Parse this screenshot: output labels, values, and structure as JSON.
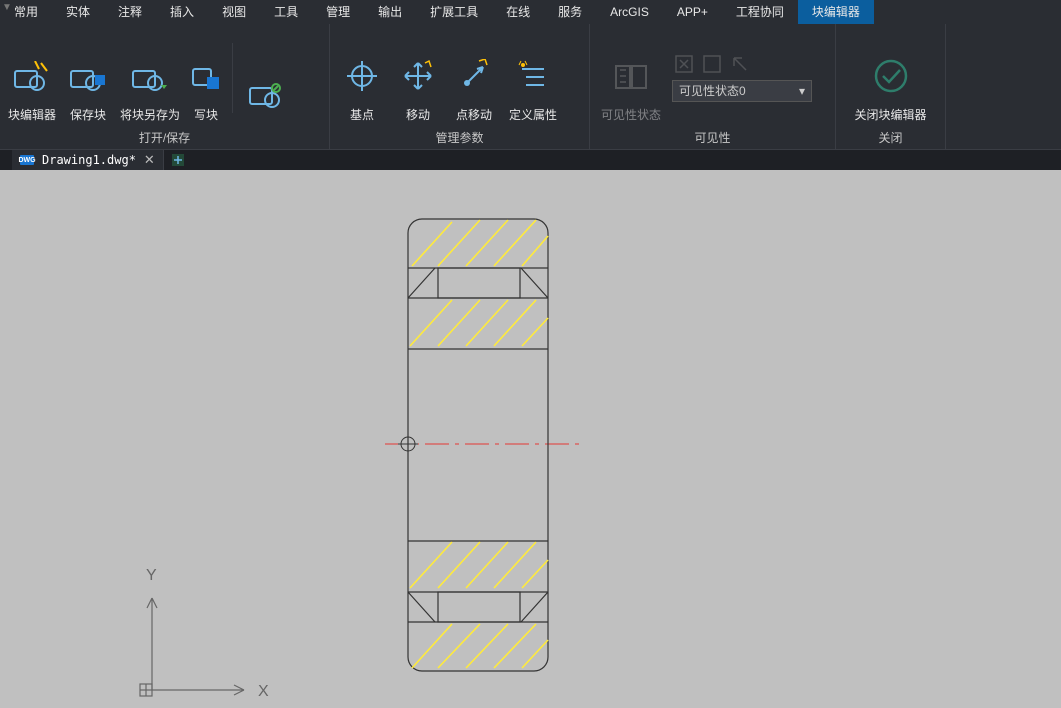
{
  "menubar": {
    "items": [
      "常用",
      "实体",
      "注释",
      "插入",
      "视图",
      "工具",
      "管理",
      "输出",
      "扩展工具",
      "在线",
      "服务",
      "ArcGIS",
      "APP+",
      "工程协同",
      "块编辑器"
    ],
    "active_index": 14
  },
  "ribbon": {
    "panels": [
      {
        "title": "打开/保存",
        "buttons": [
          {
            "label": "块编辑器",
            "icon": "block-editor"
          },
          {
            "label": "保存块",
            "icon": "save-block"
          },
          {
            "label": "将块另存为",
            "icon": "saveas-block"
          },
          {
            "label": "写块",
            "icon": "write-block"
          },
          {
            "sep": true
          },
          {
            "label": "测试块",
            "icon": "test-block"
          }
        ]
      },
      {
        "title": "管理参数",
        "buttons": [
          {
            "label": "基点",
            "icon": "basepoint"
          },
          {
            "label": "移动",
            "icon": "move"
          },
          {
            "label": "点移动",
            "icon": "point-move"
          },
          {
            "label": "定义属性",
            "icon": "def-attr"
          }
        ]
      },
      {
        "title": "可见性",
        "buttons": [
          {
            "label": "可见性状态",
            "icon": "vis-state",
            "disabled": true
          }
        ],
        "combo": {
          "value": "可见性状态0"
        }
      },
      {
        "title": "关闭",
        "buttons": [
          {
            "label": "关闭块编辑器",
            "icon": "close-editor"
          }
        ]
      }
    ]
  },
  "doctab": {
    "filename": "Drawing1.dwg*",
    "icon_label": "DWG"
  },
  "ucs": {
    "x_label": "X",
    "y_label": "Y"
  },
  "vmark": "▼"
}
